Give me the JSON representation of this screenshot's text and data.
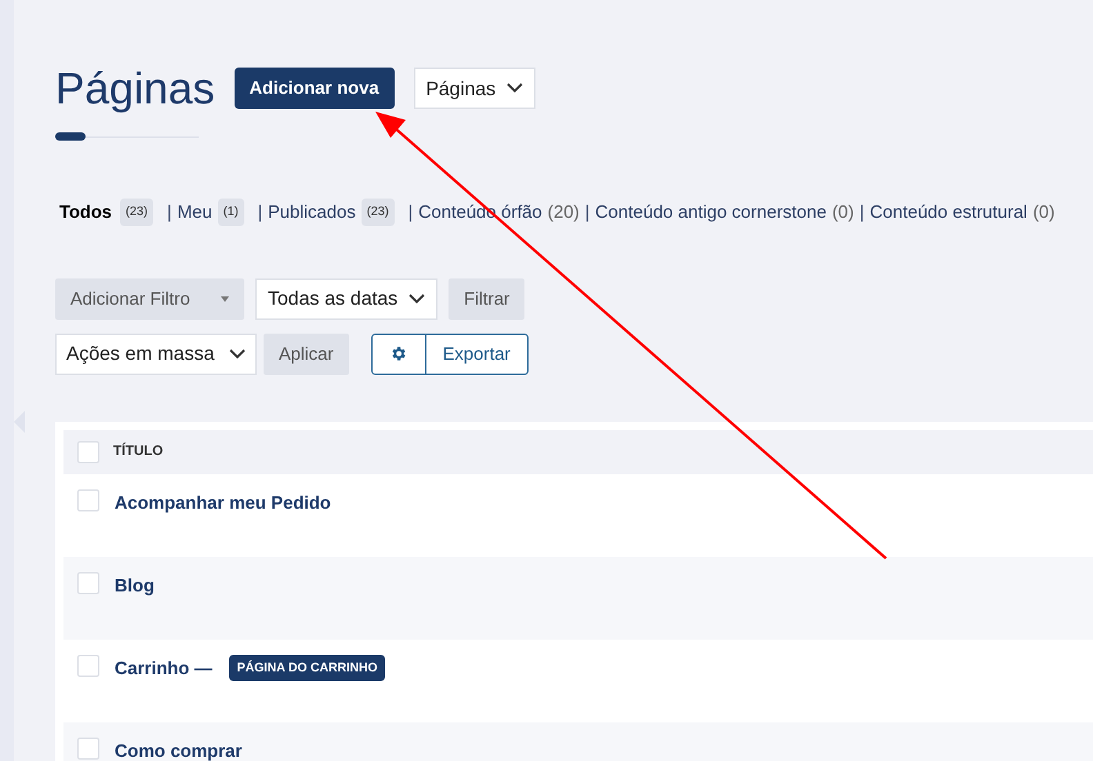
{
  "header": {
    "title": "Páginas",
    "add_button": "Adicionar nova",
    "type_select": "Páginas"
  },
  "filters": [
    {
      "label": "Todos",
      "count": "(23)",
      "kind": "badge",
      "selected": true
    },
    {
      "label": "Meu",
      "count": "(1)",
      "kind": "badge",
      "selected": false,
      "separator": "|"
    },
    {
      "label": "Publicados",
      "count": "(23)",
      "kind": "badge",
      "selected": false,
      "separator": "|"
    },
    {
      "label": "Conteúdo órfão",
      "count": "(20)",
      "kind": "paren",
      "selected": false,
      "separator": "|"
    },
    {
      "label": "Conteúdo antigo cornerstone",
      "count": "(0)",
      "kind": "paren",
      "selected": false,
      "separator": "|"
    },
    {
      "label": "Conteúdo estrutural",
      "count": "(0)",
      "kind": "paren",
      "selected": false,
      "separator": "|"
    }
  ],
  "toolbar": {
    "add_filter": "Adicionar Filtro",
    "dates": "Todas as datas",
    "filter_button": "Filtrar",
    "bulk_actions": "Ações em massa",
    "apply_button": "Aplicar",
    "export_button": "Exportar"
  },
  "table": {
    "columns": [
      "TÍTULO"
    ],
    "select_all_checked": false,
    "rows": [
      {
        "title": "Acompanhar meu Pedido",
        "checked": false
      },
      {
        "title": "Blog",
        "checked": false
      },
      {
        "title": "Carrinho —",
        "badge": "PÁGINA DO CARRINHO",
        "checked": false
      },
      {
        "title": "Como comprar",
        "checked": false
      }
    ]
  }
}
